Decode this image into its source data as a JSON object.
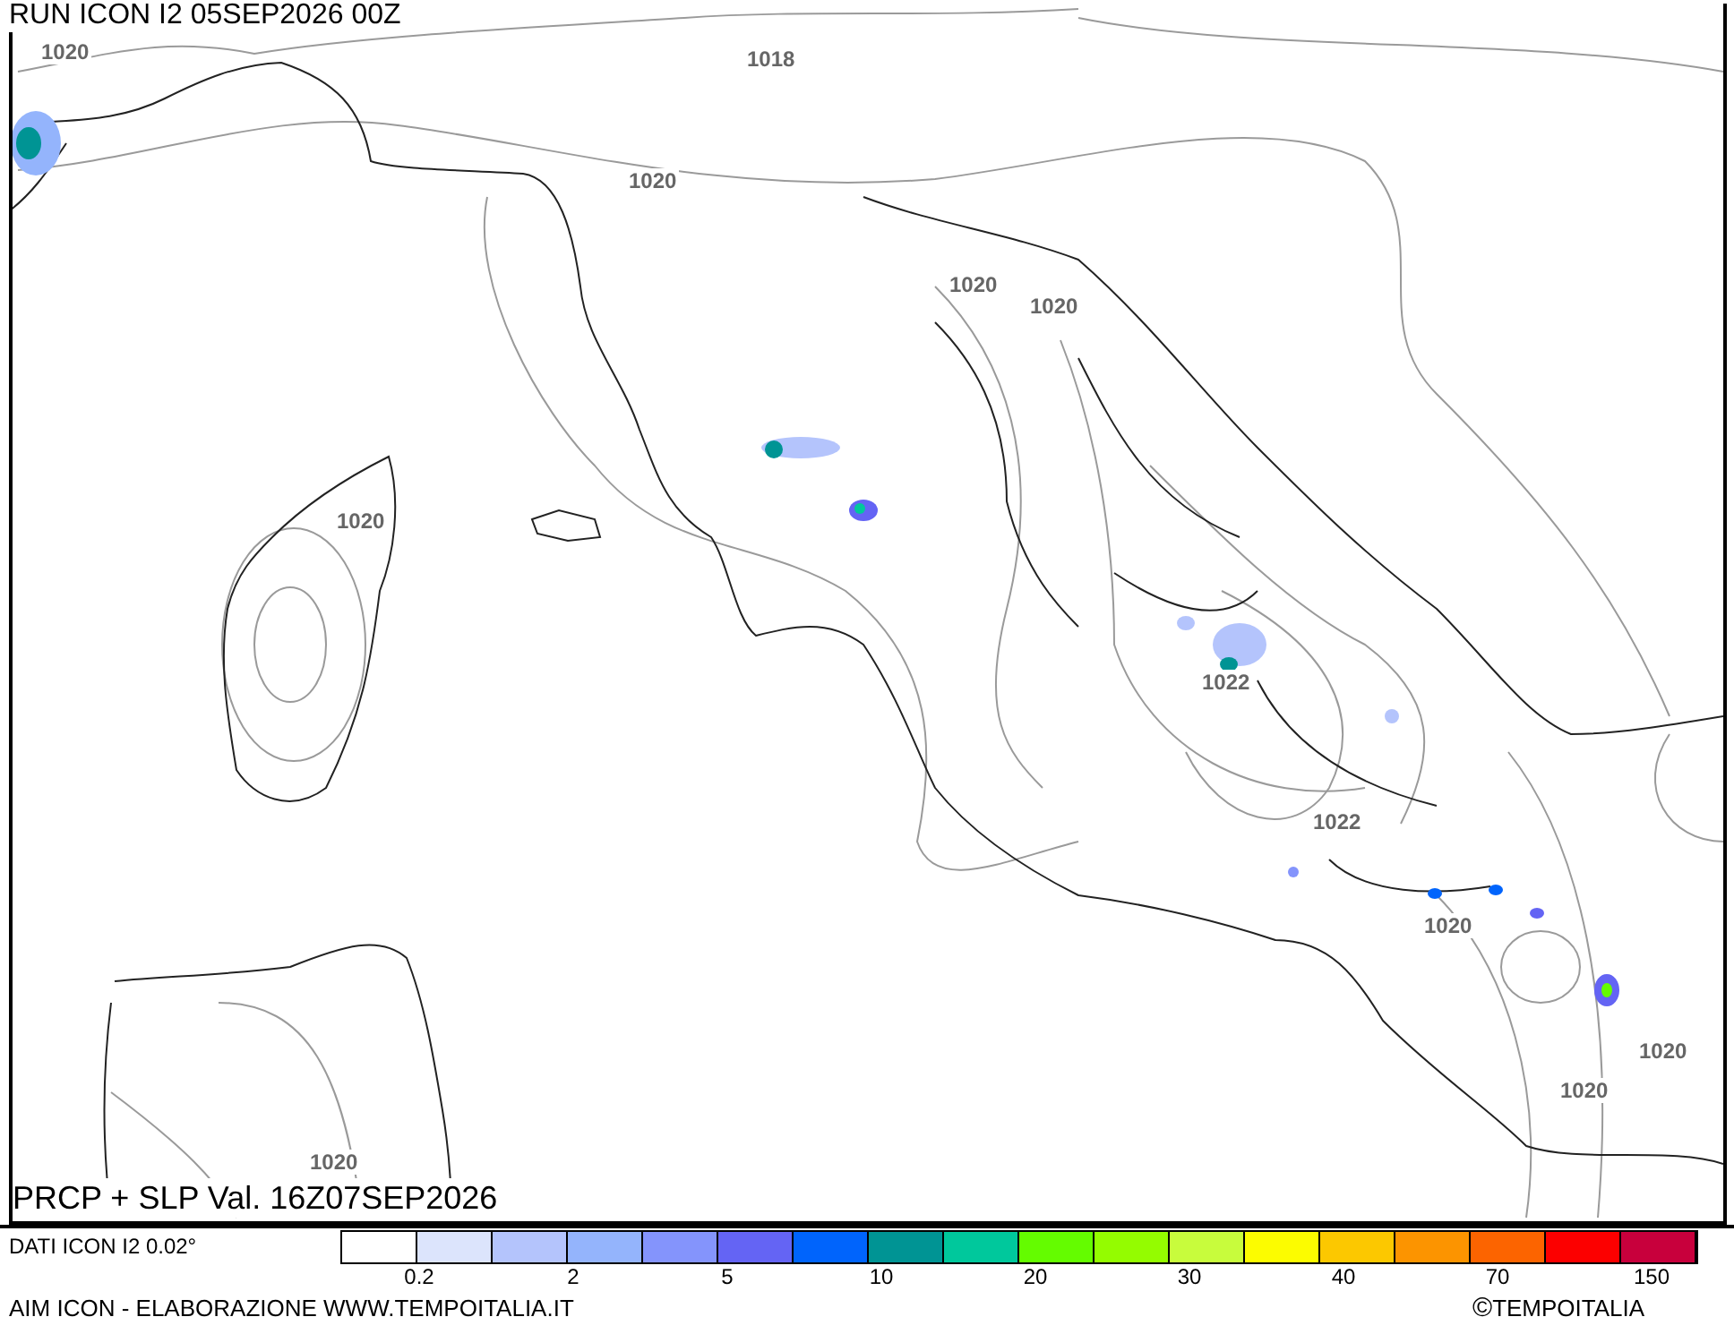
{
  "run_title": "RUN ICON I2 05SEP2026 00Z",
  "map": {
    "isobar_labels": [
      "1020",
      "1018",
      "1020",
      "1020",
      "1020",
      "1020",
      "1022",
      "1022",
      "1020",
      "1020",
      "1020",
      "1020"
    ]
  },
  "product_title": "PRCP + SLP Val. 16Z07SEP2026",
  "data_source": "DATI ICON I2 0.02°",
  "legend": {
    "boxes": [
      {
        "color": "#ffffff"
      },
      {
        "color": "#dce4fc"
      },
      {
        "color": "#b4c4fc"
      },
      {
        "color": "#94b4fc"
      },
      {
        "color": "#8494fc"
      },
      {
        "color": "#6464f4"
      },
      {
        "color": "#0064fc"
      },
      {
        "color": "#009494"
      },
      {
        "color": "#00c89c"
      },
      {
        "color": "#64fc00"
      },
      {
        "color": "#94fc00"
      },
      {
        "color": "#c8fc3c"
      },
      {
        "color": "#fcfc00"
      },
      {
        "color": "#fcc800"
      },
      {
        "color": "#fc9400"
      },
      {
        "color": "#fc6400"
      },
      {
        "color": "#fc0000"
      },
      {
        "color": "#c8003c"
      }
    ],
    "ticks": [
      "0.2",
      "2",
      "5",
      "10",
      "20",
      "30",
      "40",
      "70",
      "150"
    ]
  },
  "credit": "AIM ICON - ELABORAZIONE WWW.TEMPOITALIA.IT",
  "copyright_symbol": "©",
  "copyright": "TEMPOITALIA"
}
